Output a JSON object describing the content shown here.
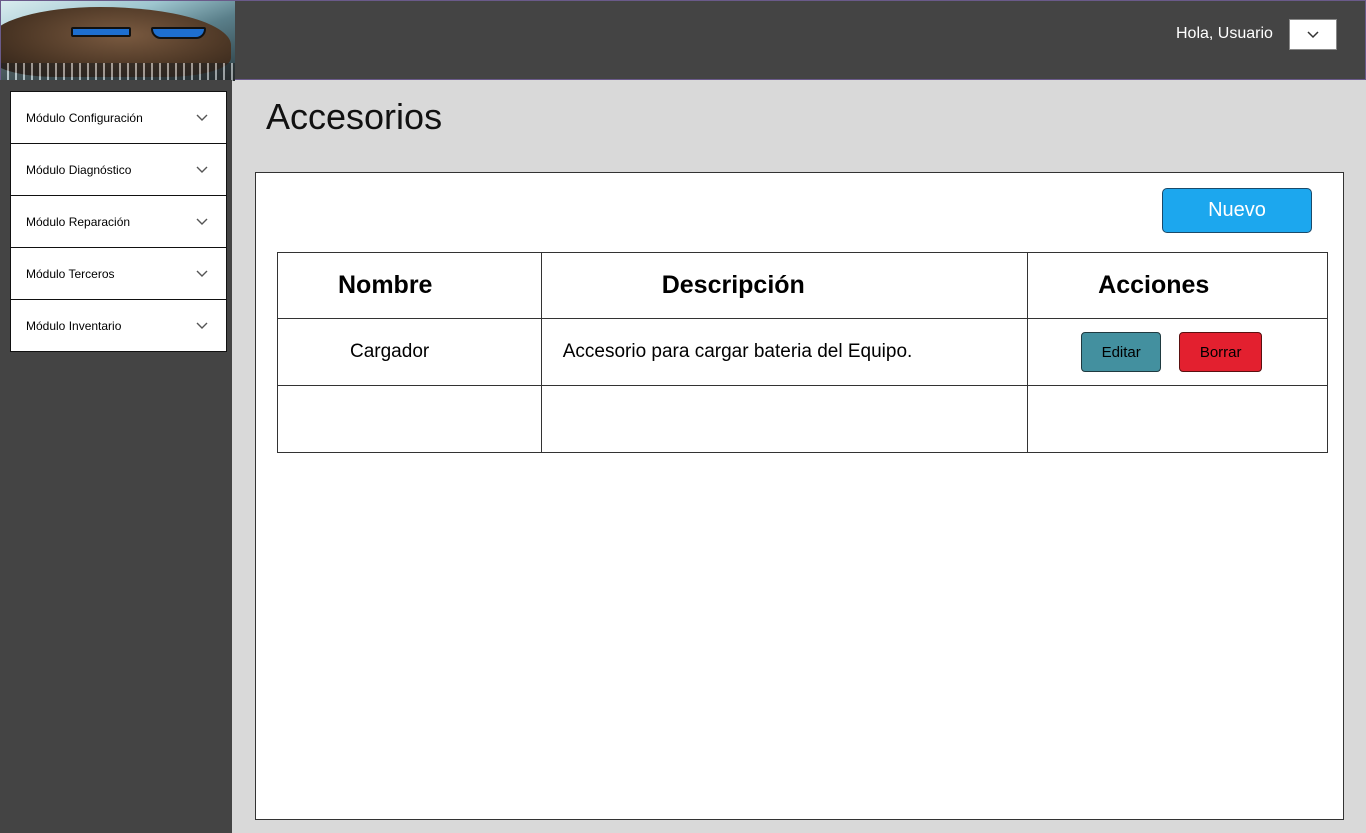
{
  "header": {
    "greeting": "Hola, Usuario",
    "user_menu_icon": "chevron-down-icon"
  },
  "sidebar": {
    "items": [
      {
        "label": "Módulo Configuración",
        "icon": "chevron-down-icon"
      },
      {
        "label": "Módulo Diagnóstico",
        "icon": "chevron-down-icon"
      },
      {
        "label": "Módulo Reparación",
        "icon": "chevron-down-icon"
      },
      {
        "label": "Módulo Terceros",
        "icon": "chevron-down-icon"
      },
      {
        "label": "Módulo Inventario",
        "icon": "chevron-down-icon"
      }
    ]
  },
  "main": {
    "title": "Accesorios",
    "new_button": "Nuevo",
    "table": {
      "headers": [
        "Nombre",
        "Descripción",
        "Acciones"
      ],
      "rows": [
        {
          "name": "Cargador",
          "description": "Accesorio para cargar bateria del Equipo.",
          "edit_label": "Editar",
          "delete_label": "Borrar"
        }
      ]
    }
  },
  "colors": {
    "topbar": "#444444",
    "new_button": "#1ca7ee",
    "edit_button": "#43909f",
    "delete_button": "#e3202f"
  }
}
